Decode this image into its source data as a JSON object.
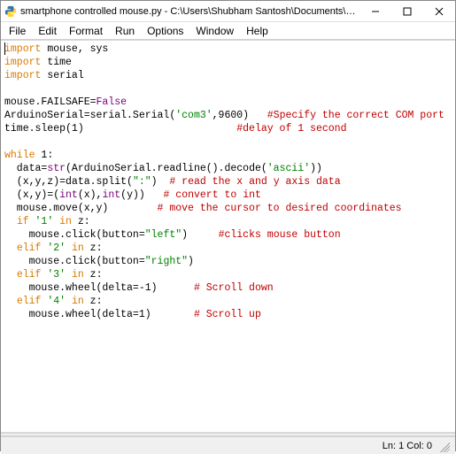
{
  "window": {
    "title": "smartphone controlled mouse.py - C:\\Users\\Shubham Santosh\\Documents\\python program..."
  },
  "menu": {
    "items": [
      "File",
      "Edit",
      "Format",
      "Run",
      "Options",
      "Window",
      "Help"
    ]
  },
  "code": {
    "lines": [
      [
        {
          "t": "import",
          "c": "kw"
        },
        {
          "t": " mouse, sys"
        }
      ],
      [
        {
          "t": "import",
          "c": "kw"
        },
        {
          "t": " time"
        }
      ],
      [
        {
          "t": "import",
          "c": "kw"
        },
        {
          "t": " serial"
        }
      ],
      [],
      [
        {
          "t": "mouse.FAILSAFE="
        },
        {
          "t": "False",
          "c": "bi"
        }
      ],
      [
        {
          "t": "ArduinoSerial=serial.Serial("
        },
        {
          "t": "'com3'",
          "c": "str"
        },
        {
          "t": ",9600)   "
        },
        {
          "t": "#Specify the correct COM port",
          "c": "cmt"
        }
      ],
      [
        {
          "t": "time.sleep(1)                         "
        },
        {
          "t": "#delay of 1 second",
          "c": "cmt"
        }
      ],
      [],
      [
        {
          "t": "while",
          "c": "kw"
        },
        {
          "t": " 1:"
        }
      ],
      [
        {
          "t": "  data="
        },
        {
          "t": "str",
          "c": "bi"
        },
        {
          "t": "(ArduinoSerial.readline().decode("
        },
        {
          "t": "'ascii'",
          "c": "str"
        },
        {
          "t": "))"
        }
      ],
      [
        {
          "t": "  (x,y,z)=data.split("
        },
        {
          "t": "\":\"",
          "c": "str"
        },
        {
          "t": ")  "
        },
        {
          "t": "# read the x and y axis data",
          "c": "cmt"
        }
      ],
      [
        {
          "t": "  (x,y)=("
        },
        {
          "t": "int",
          "c": "bi"
        },
        {
          "t": "(x),"
        },
        {
          "t": "int",
          "c": "bi"
        },
        {
          "t": "(y))   "
        },
        {
          "t": "# convert to int",
          "c": "cmt"
        }
      ],
      [
        {
          "t": "  mouse.move(x,y)        "
        },
        {
          "t": "# move the cursor to desired coordinates",
          "c": "cmt"
        }
      ],
      [
        {
          "t": "  "
        },
        {
          "t": "if",
          "c": "kw"
        },
        {
          "t": " "
        },
        {
          "t": "'1'",
          "c": "str"
        },
        {
          "t": " "
        },
        {
          "t": "in",
          "c": "kw"
        },
        {
          "t": " z:"
        }
      ],
      [
        {
          "t": "    mouse.click(button="
        },
        {
          "t": "\"left\"",
          "c": "str"
        },
        {
          "t": ")     "
        },
        {
          "t": "#clicks mouse button",
          "c": "cmt"
        }
      ],
      [
        {
          "t": "  "
        },
        {
          "t": "elif",
          "c": "kw"
        },
        {
          "t": " "
        },
        {
          "t": "'2'",
          "c": "str"
        },
        {
          "t": " "
        },
        {
          "t": "in",
          "c": "kw"
        },
        {
          "t": " z:"
        }
      ],
      [
        {
          "t": "    mouse.click(button="
        },
        {
          "t": "\"right\"",
          "c": "str"
        },
        {
          "t": ")"
        }
      ],
      [
        {
          "t": "  "
        },
        {
          "t": "elif",
          "c": "kw"
        },
        {
          "t": " "
        },
        {
          "t": "'3'",
          "c": "str"
        },
        {
          "t": " "
        },
        {
          "t": "in",
          "c": "kw"
        },
        {
          "t": " z:"
        }
      ],
      [
        {
          "t": "    mouse.wheel(delta=-1)      "
        },
        {
          "t": "# Scroll down",
          "c": "cmt"
        }
      ],
      [
        {
          "t": "  "
        },
        {
          "t": "elif",
          "c": "kw"
        },
        {
          "t": " "
        },
        {
          "t": "'4'",
          "c": "str"
        },
        {
          "t": " "
        },
        {
          "t": "in",
          "c": "kw"
        },
        {
          "t": " z:"
        }
      ],
      [
        {
          "t": "    mouse.wheel(delta=1)       "
        },
        {
          "t": "# Scroll up",
          "c": "cmt"
        }
      ]
    ]
  },
  "status": {
    "position": "Ln: 1  Col: 0"
  }
}
